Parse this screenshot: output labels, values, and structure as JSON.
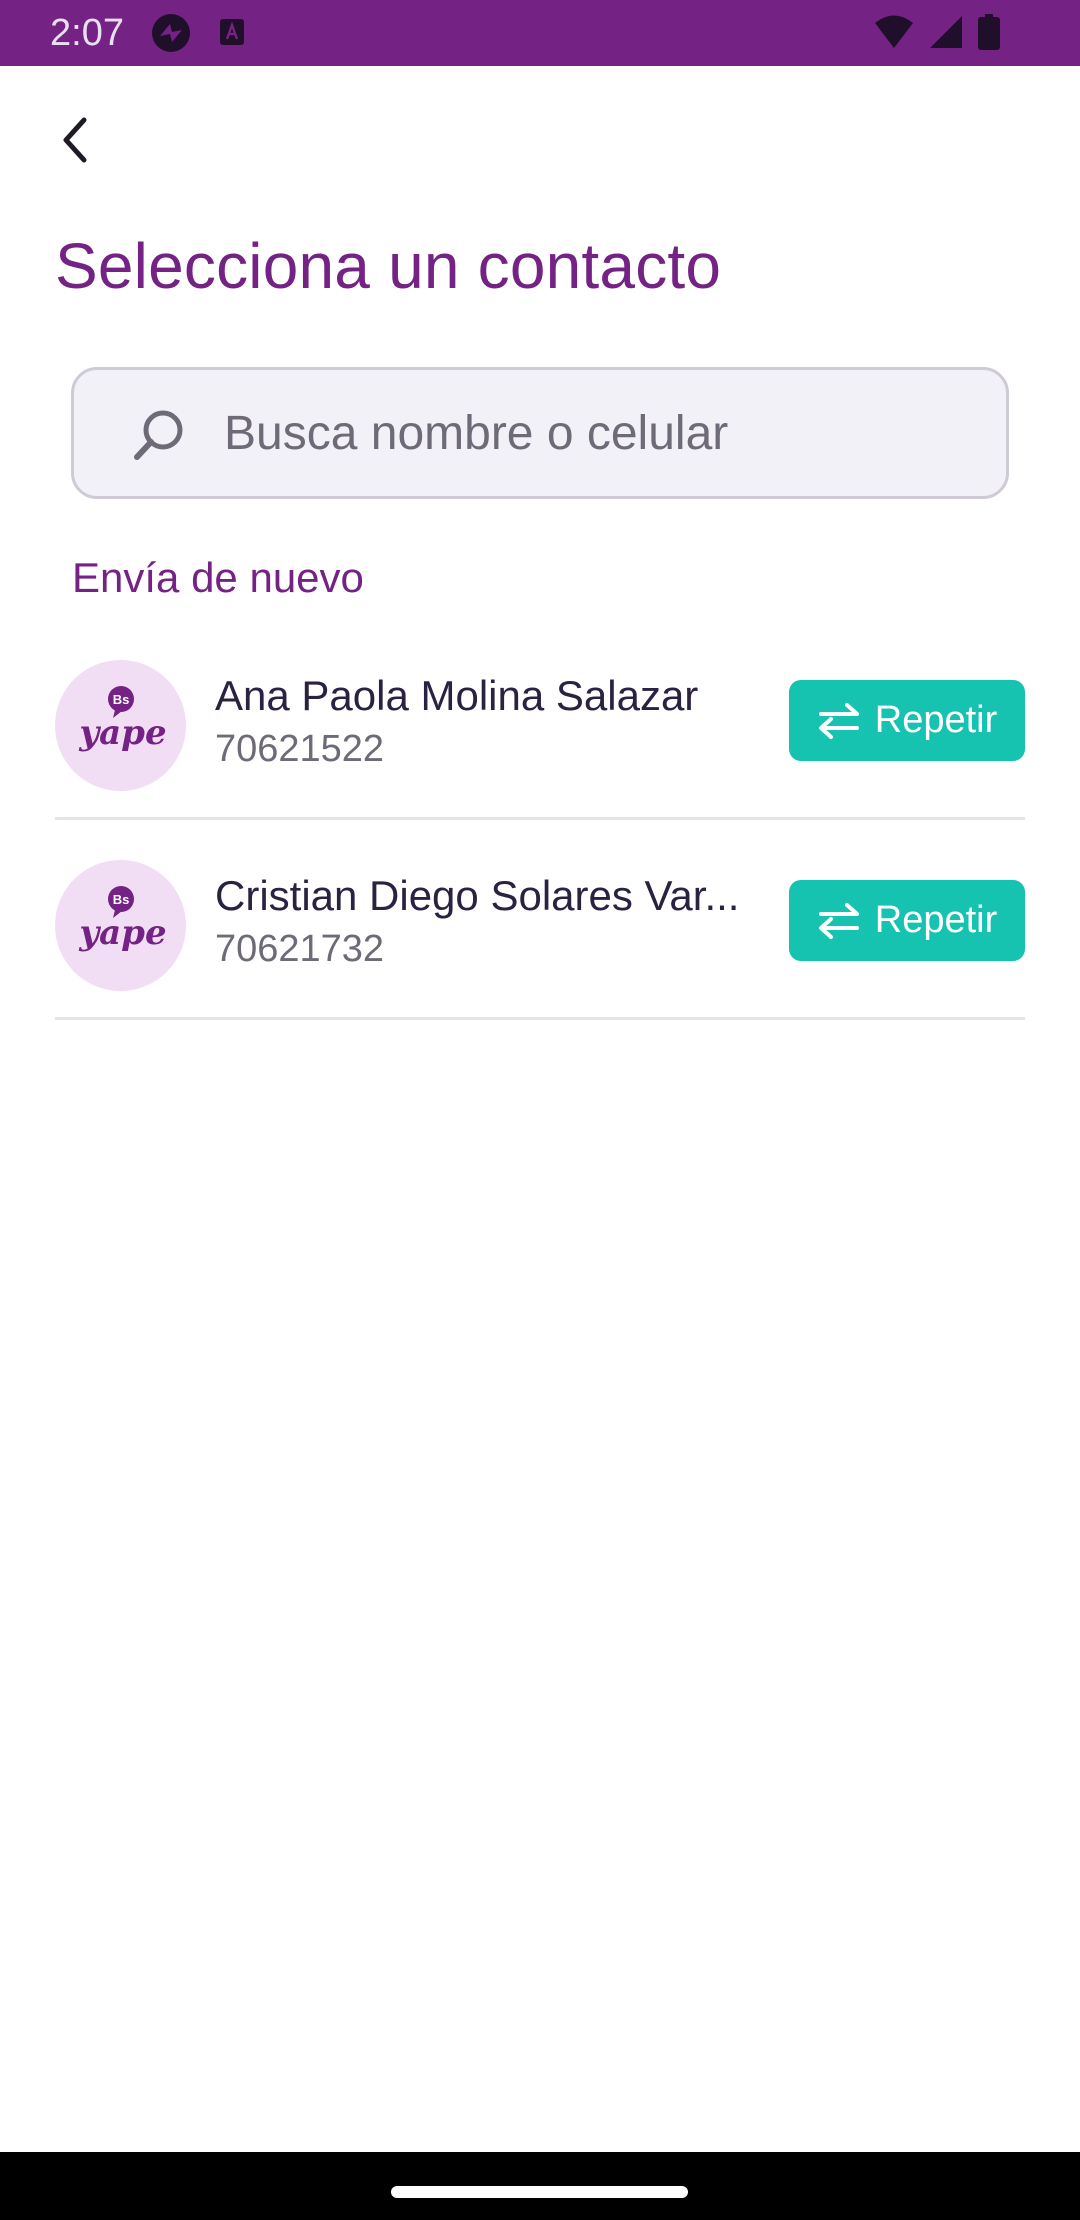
{
  "status_bar": {
    "time": "2:07",
    "icons": [
      "app-notification-icon",
      "app-notification-icon",
      "wifi-icon",
      "signal-icon",
      "battery-icon"
    ]
  },
  "header": {
    "back_icon": "chevron-left-icon",
    "title": "Selecciona un contacto"
  },
  "search": {
    "placeholder": "Busca nombre o celular",
    "value": "",
    "icon": "search-icon"
  },
  "recent": {
    "label": "Envía de nuevo",
    "contacts": [
      {
        "name": "Ana Paola Molina Salazar",
        "phone": "70621522",
        "avatar_text": "yape",
        "avatar_badge": "Bs",
        "action_label": "Repetir"
      },
      {
        "name": "Cristian Diego Solares Var...",
        "phone": "70621732",
        "avatar_text": "yape",
        "avatar_badge": "Bs",
        "action_label": "Repetir"
      }
    ]
  },
  "colors": {
    "brand_purple": "#742284",
    "accent_teal": "#16c3b0",
    "search_bg": "#f3f1f8",
    "avatar_bg": "#f1ddf4"
  }
}
